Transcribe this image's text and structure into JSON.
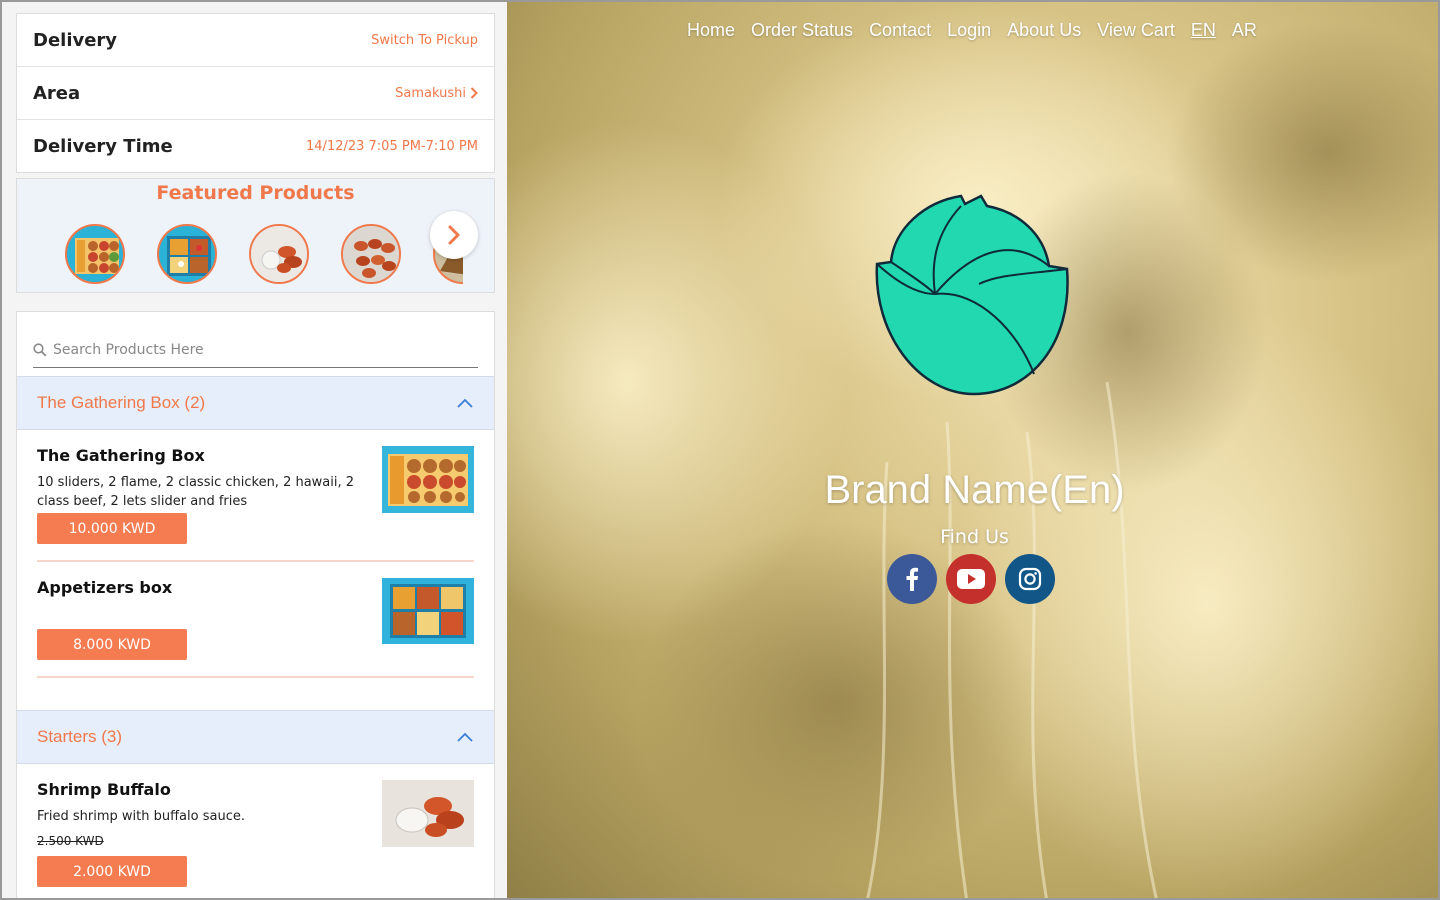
{
  "delivery": {
    "mode_label": "Delivery",
    "switch_label": "Switch To Pickup",
    "area_label": "Area",
    "area_value": "Samakushi",
    "time_label": "Delivery Time",
    "time_value": "14/12/23 7:05 PM-7:10 PM"
  },
  "featured": {
    "title": "Featured Products",
    "next_icon": "chevron-right-icon"
  },
  "search": {
    "placeholder": "Search Products Here"
  },
  "categories": [
    {
      "title": "The Gathering Box (2)",
      "products": [
        {
          "name": "The Gathering Box",
          "description": "10 sliders, 2 flame, 2 classic chicken, 2 hawaii, 2 class beef, 2 lets slider and fries",
          "price": "10.000 KWD"
        },
        {
          "name": "Appetizers box",
          "description": "",
          "price": "8.000 KWD"
        }
      ]
    },
    {
      "title": "Starters (3)",
      "products": [
        {
          "name": "Shrimp Buffalo",
          "description": "Fried shrimp with buffalo sauce.",
          "old_price": "2.500 KWD",
          "price": "2.000 KWD"
        }
      ]
    }
  ],
  "nav": {
    "home": "Home",
    "order_status": "Order Status",
    "contact": "Contact",
    "login": "Login",
    "about": "About Us",
    "cart": "View Cart",
    "en": "EN",
    "ar": "AR"
  },
  "hero": {
    "brand": "Brand Name(En)",
    "find_us": "Find Us"
  },
  "colors": {
    "accent": "#f0784a",
    "facebook": "#3b5998",
    "youtube": "#c4302b",
    "instagram": "#125688"
  }
}
